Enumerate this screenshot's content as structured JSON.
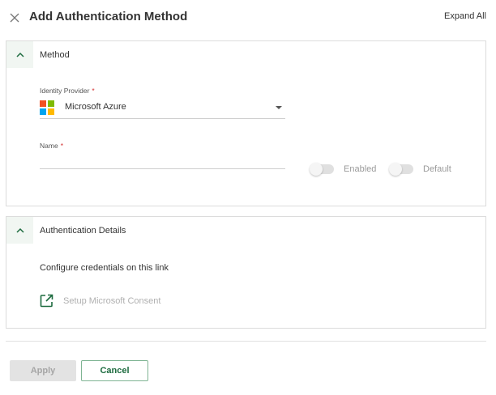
{
  "header": {
    "title": "Add Authentication Method",
    "expand_all_label": "Expand All",
    "close_icon": "close-icon"
  },
  "method_panel": {
    "title": "Method",
    "identity_provider": {
      "label": "Identity Provider",
      "required_mark": "*",
      "value": "Microsoft Azure",
      "logo_icon": "microsoft-logo-icon",
      "logo_colors": [
        "#f25022",
        "#7fba00",
        "#00a4ef",
        "#ffb900"
      ]
    },
    "name": {
      "label": "Name",
      "required_mark": "*",
      "value": ""
    },
    "enabled_toggle": {
      "label": "Enabled",
      "on": false
    },
    "default_toggle": {
      "label": "Default",
      "on": false
    }
  },
  "auth_panel": {
    "title": "Authentication Details",
    "description": "Configure credentials on this link",
    "consent_link_label": "Setup Microsoft Consent",
    "consent_icon": "external-link-icon"
  },
  "footer": {
    "apply_label": "Apply",
    "cancel_label": "Cancel"
  },
  "colors": {
    "accent_green": "#1d6b3f",
    "required_red": "#d32f2f",
    "panel_header_bg": "#f1f6f2"
  }
}
